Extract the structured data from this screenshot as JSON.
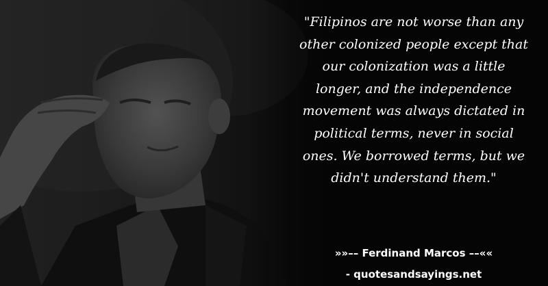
{
  "quote": {
    "lines": [
      "\"Filipinos are not worse than any",
      "other colonized people except that",
      "our colonization was a little",
      "longer, and the independence",
      "movement was always dictated in",
      "political terms, never in social",
      "ones. We borrowed terms, but we",
      "didn't understand them.\""
    ]
  },
  "attribution": "»»–– Ferdinand Marcos ––««",
  "site": "- quotesandsayings.net",
  "image": {
    "subject": "portrait-of-man-saluting",
    "colors": {
      "background": "#0b0b0b",
      "text": "#ffffff"
    }
  }
}
